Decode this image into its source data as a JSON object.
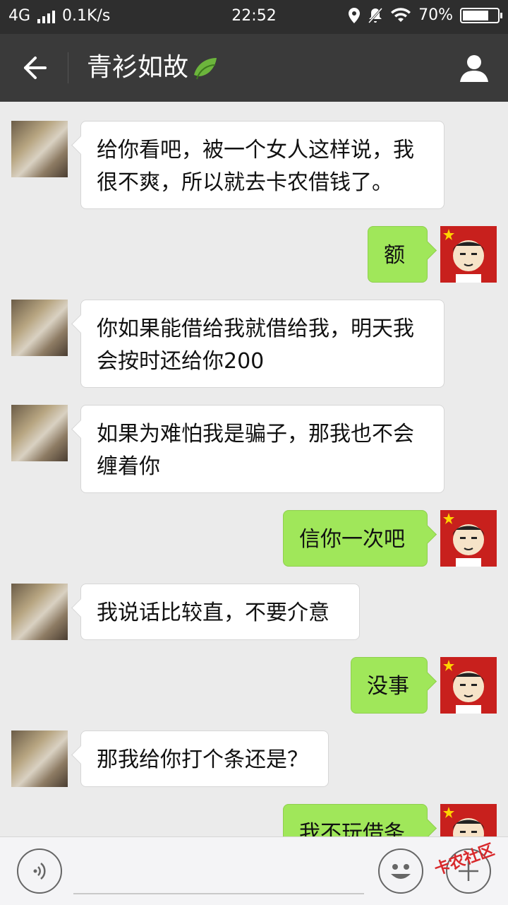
{
  "status_bar": {
    "network": "4G",
    "speed": "0.1K/s",
    "time": "22:52",
    "battery": "70%",
    "battery_level": 0.7
  },
  "nav": {
    "title": "青衫如故",
    "title_icon": "leaf-icon",
    "back_icon": "back-arrow-icon",
    "profile_icon": "user-profile-icon"
  },
  "messages": [
    {
      "sender": "other",
      "text": "给你看吧，被一个女人这样说，我很不爽，所以就去卡农借钱了。"
    },
    {
      "sender": "self",
      "text": "额"
    },
    {
      "sender": "other",
      "text": "你如果能借给我就借给我，明天我会按时还给你200"
    },
    {
      "sender": "other",
      "text": "如果为难怕我是骗子，那我也不会缠着你"
    },
    {
      "sender": "self",
      "text": "信你一次吧"
    },
    {
      "sender": "other",
      "text": "我说话比较直，不要介意"
    },
    {
      "sender": "self",
      "text": "没事"
    },
    {
      "sender": "other",
      "text": "那我给你打个条还是？"
    },
    {
      "sender": "self",
      "text": "我不玩借条"
    }
  ],
  "input_bar": {
    "voice_icon": "voice-icon",
    "emoji_icon": "emoji-icon",
    "plus_icon": "plus-icon"
  },
  "watermark": "卡农社区",
  "colors": {
    "status_bg": "#2e2e2e",
    "nav_bg": "#3a3a3a",
    "chat_bg": "#ebebeb",
    "self_bubble": "#a0e75a",
    "other_bubble": "#ffffff"
  }
}
